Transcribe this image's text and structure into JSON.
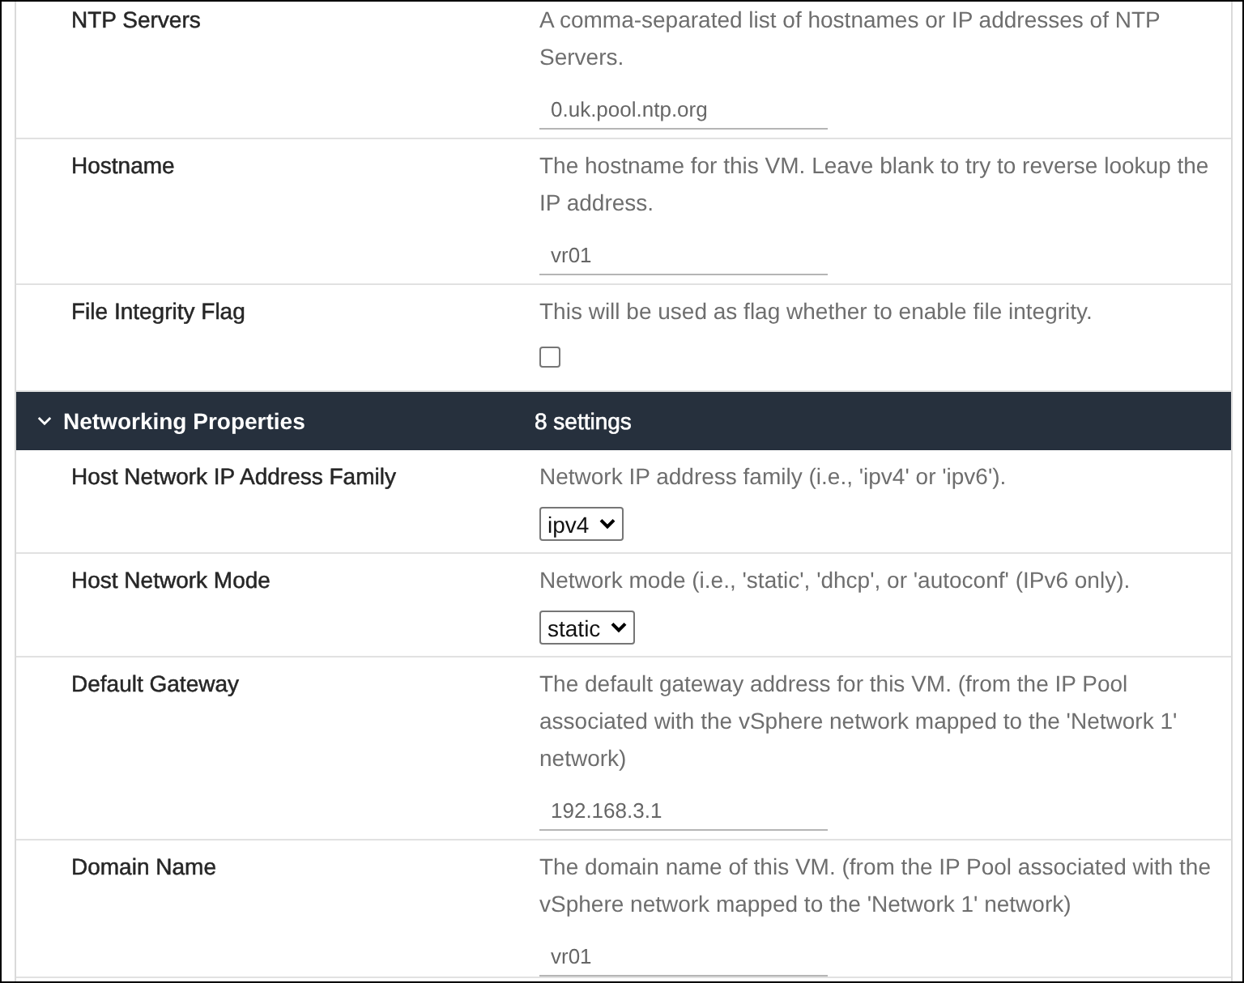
{
  "properties": [
    {
      "kind": "text",
      "label": "NTP Servers",
      "description": "A comma-separated list of hostnames or IP addresses of NTP Servers.",
      "value": "0.uk.pool.ntp.org"
    },
    {
      "kind": "text",
      "label": "Hostname",
      "description": "The hostname for this VM. Leave blank to try to reverse lookup the IP address.",
      "value": "vr01"
    },
    {
      "kind": "checkbox",
      "label": "File Integrity Flag",
      "description": "This will be used as flag whether to enable file integrity.",
      "checked": false
    }
  ],
  "section": {
    "title": "Networking Properties",
    "count": "8 settings",
    "expanded": true,
    "properties": [
      {
        "kind": "select",
        "label": "Host Network IP Address Family",
        "description": "Network IP address family (i.e., 'ipv4' or 'ipv6').",
        "value": "ipv4"
      },
      {
        "kind": "select",
        "label": "Host Network Mode",
        "description": "Network mode (i.e., 'static', 'dhcp', or 'autoconf' (IPv6 only).",
        "value": "static"
      },
      {
        "kind": "text",
        "label": "Default Gateway",
        "description": "The default gateway address for this VM. (from the IP Pool\nassociated with the vSphere network mapped to the 'Network 1' network)",
        "value": "192.168.3.1"
      },
      {
        "kind": "text",
        "label": "Domain Name",
        "description": "The domain name of this VM. (from the IP Pool associated with the vSphere network mapped to the 'Network 1' network)",
        "value": "vr01"
      }
    ]
  }
}
